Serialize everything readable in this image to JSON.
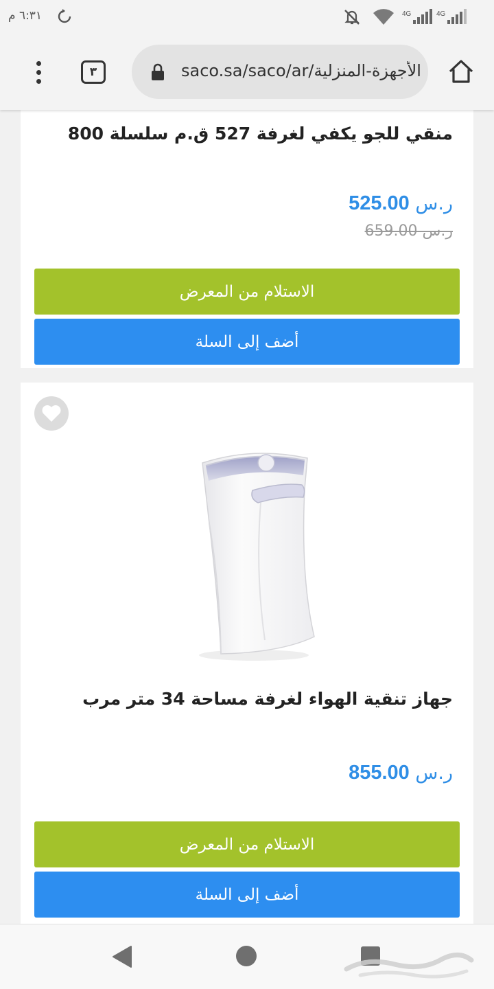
{
  "status_bar": {
    "time": "٦:٣١ م",
    "network_1": "4G",
    "network_2": "4G"
  },
  "browser": {
    "tab_count": "٣",
    "url": "saco.sa/saco/ar/الأجهزة-المنزلية/"
  },
  "products": [
    {
      "title": "منقي للجو يكفي لغرفة 527 ق.م سلسلة 800",
      "currency": "ر.س",
      "price": "525.00",
      "old_price": "ر.س 659.00",
      "pickup_label": "الاستلام من المعرض",
      "cart_label": "أضف إلى السلة"
    },
    {
      "title": "جهاز تنقية الهواء لغرفة مساحة 34 متر مرب",
      "currency": "ر.س",
      "price": "855.00",
      "pickup_label": "الاستلام من المعرض",
      "cart_label": "أضف إلى السلة"
    }
  ],
  "icons": {
    "refresh": "refresh-icon",
    "mute": "bell-off-icon",
    "wifi": "wifi-icon",
    "lock": "lock-icon",
    "home": "home-icon",
    "wishlist": "heart-icon",
    "nav_back": "back-triangle-icon",
    "nav_home": "home-circle-icon",
    "nav_recent": "recent-apps-icon"
  },
  "colors": {
    "price_blue": "#2f8ee6",
    "pickup_green": "#a3c22b",
    "cart_blue": "#2d8ef0"
  }
}
